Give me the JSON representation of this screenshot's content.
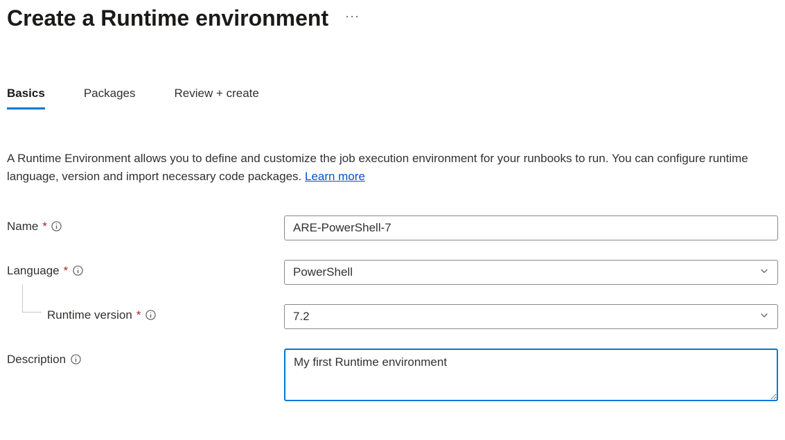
{
  "header": {
    "title": "Create a Runtime environment"
  },
  "tabs": [
    {
      "label": "Basics",
      "active": true
    },
    {
      "label": "Packages",
      "active": false
    },
    {
      "label": "Review + create",
      "active": false
    }
  ],
  "intro": {
    "text": "A Runtime Environment allows you to define and customize the job execution environment for your runbooks to run. You can configure runtime language, version and import necessary code packages. ",
    "link_label": "Learn more"
  },
  "form": {
    "name": {
      "label": "Name",
      "required": true,
      "value": "ARE-PowerShell-7"
    },
    "language": {
      "label": "Language",
      "required": true,
      "value": "PowerShell"
    },
    "runtime_version": {
      "label": "Runtime version",
      "required": true,
      "value": "7.2"
    },
    "description": {
      "label": "Description",
      "required": false,
      "value": "My first Runtime environment"
    }
  }
}
